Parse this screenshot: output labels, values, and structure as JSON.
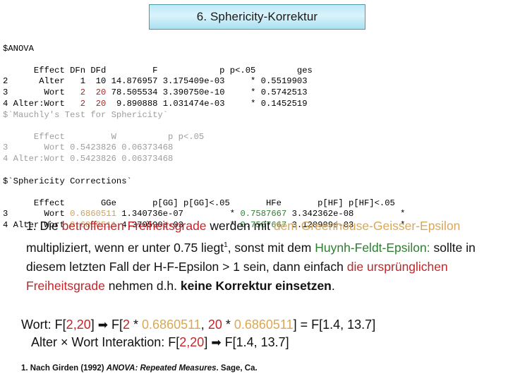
{
  "slide": {
    "title": "6. Sphericity-Korrektur"
  },
  "console": {
    "anova": {
      "header_label": "$ANOVA",
      "columns_line": "      Effect DFn DFd         F            p p<.05        ges",
      "rows": [
        {
          "num": "2",
          "effect": "Alter",
          "dfn": "1",
          "dfd": "10",
          "f": "14.876957",
          "p": "3.175409e-03",
          "sig": "*",
          "ges": "0.5519903",
          "df_highlighted": false
        },
        {
          "num": "3",
          "effect": "Wort",
          "dfn": "2",
          "dfd": "20",
          "f": "78.505534",
          "p": "3.390750e-10",
          "sig": "*",
          "ges": "0.5742513",
          "df_highlighted": true
        },
        {
          "num": "4",
          "effect": "Alter:Wort",
          "dfn": "2",
          "dfd": "20",
          "f": "9.890888",
          "p": "1.031474e-03",
          "sig": "*",
          "ges": "0.1452519",
          "df_highlighted": true
        }
      ]
    },
    "mauchly": {
      "header_label": "$`Mauchly's Test for Sphericity`",
      "columns_line": "      Effect         W          p p<.05",
      "rows": [
        {
          "num": "3",
          "effect": "Wort",
          "w": "0.5423826",
          "p": "0.06373468"
        },
        {
          "num": "4",
          "effect": "Alter:Wort",
          "w": "0.5423826",
          "p": "0.06373468"
        }
      ]
    },
    "sphericity": {
      "header_label": "$`Sphericity Corrections`",
      "columns_line": "      Effect       GGe       p[GG] p[GG]<.05       HFe       p[HF] p[HF]<.05",
      "rows": [
        {
          "num": "3",
          "effect": "Wort",
          "gge": "0.6860511",
          "pgg": "1.340736e-07",
          "pgg_sig": "*",
          "hfe": "0.7587667",
          "phf": "3.342362e-08",
          "phf_sig": "*"
        },
        {
          "num": "4",
          "effect": "Alter:Wort",
          "gge": "0.6860511",
          "pgg": "4.370590e-03",
          "pgg_sig": "*",
          "hfe": "0.7587667",
          "phf": "3.120999e-03",
          "phf_sig": "*"
        }
      ]
    }
  },
  "paragraph": {
    "seg1": "1. Die ",
    "seg2_red": "betroffenen Freiheitsgrade",
    "seg3": " werden mit ",
    "seg4_tan": "dem Greenhouse-Geisser-Epsilon",
    "seg5": " multipliziert, wenn er unter 0.75 liegt",
    "footnote_marker": "1",
    "seg6": ", sonst mit dem ",
    "seg7_green": "Huynh-Feldt-Epsilon:",
    "seg8": " sollte in diesem letzten Fall der H-F-Epsilon > 1 sein, dann einfach ",
    "seg9_red": "die ursprünglichen Freiheitsgrade",
    "seg10": " nehmen d.h. ",
    "seg11_bold": "keine Korrektur einsetzen",
    "seg12": "."
  },
  "formulas": {
    "line1": {
      "label": "Wort: F[",
      "dfn_red": "2",
      "comma": ",",
      "dfd_red": "20",
      "close1": "] ",
      "arrow": "➡",
      "open2": " F[",
      "dfn_red_2": "2",
      "mult1": " * ",
      "gge1_tan": "0.6860511",
      "sep": ", ",
      "dfd_red_2": "20",
      "mult2": " * ",
      "gge2_tan": "0.6860511",
      "close2": "] = F[1.4,  13.7]"
    },
    "line2": {
      "label": "Alter × Wort Interaktion: F[",
      "dfn_red": "2",
      "comma": ",",
      "dfd_red": "20",
      "close1": "] ",
      "arrow": "➡",
      "result": "  F[1.4, 13.7]"
    }
  },
  "footnote": {
    "prefix": "1. Nach Girden (1992) ",
    "italic": "ANOVA: Repeated Measures",
    "suffix": ". Sage, Ca."
  }
}
